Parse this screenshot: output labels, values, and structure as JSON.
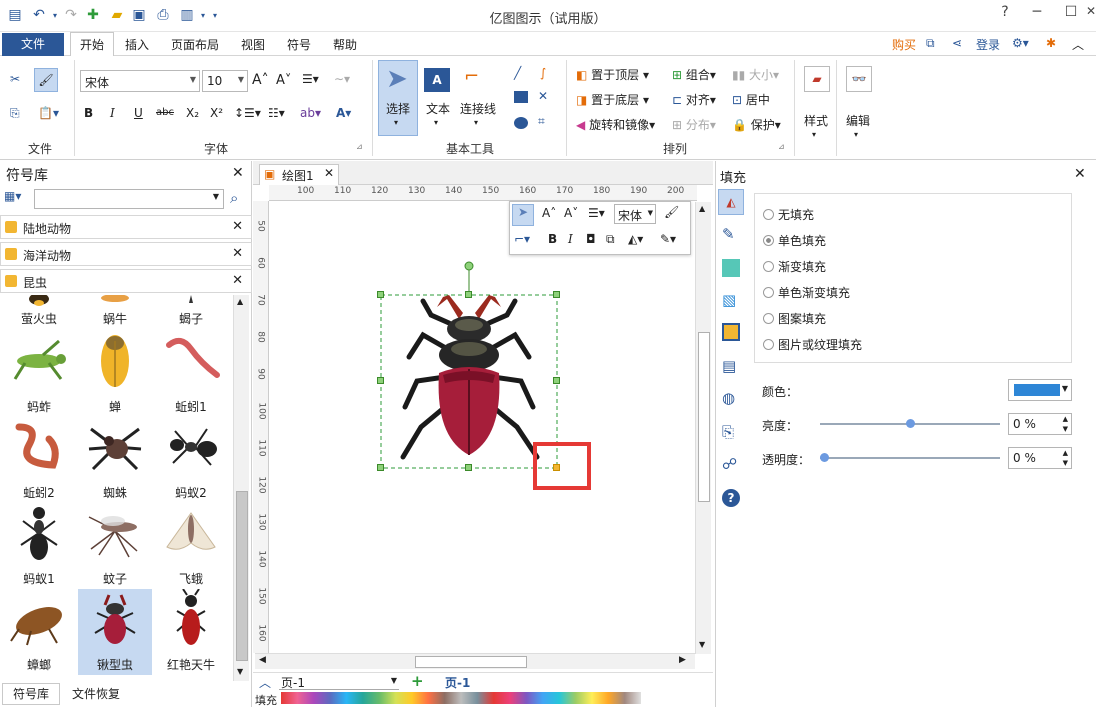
{
  "window": {
    "title": "亿图图示（试用版）",
    "buy": "购买",
    "login": "登录"
  },
  "menu": {
    "file": "文件",
    "tabs": [
      "开始",
      "插入",
      "页面布局",
      "视图",
      "符号",
      "帮助"
    ]
  },
  "ribbon": {
    "groups": {
      "file": "文件",
      "font": "字体",
      "basic": "基本工具",
      "arrange": "排列"
    },
    "font_name": "宋体",
    "font_size": "10",
    "tools": {
      "select": "选择",
      "text": "文本",
      "connector": "连接线"
    },
    "arrange": {
      "bring_front": "置于顶层",
      "send_back": "置于底层",
      "rotate": "旋转和镜像",
      "group": "组合",
      "align": "对齐",
      "distribute": "分布",
      "size": "大小",
      "center": "居中",
      "protect": "保护"
    },
    "style": "样式",
    "edit": "编辑"
  },
  "left_panel": {
    "title": "符号库",
    "search_placeholder": "",
    "libraries": [
      "陆地动物",
      "海洋动物",
      "昆虫"
    ],
    "symbols": [
      {
        "name": "萤火虫"
      },
      {
        "name": "蜗牛"
      },
      {
        "name": "蝎子"
      },
      {
        "name": "蚂蚱"
      },
      {
        "name": "蝉"
      },
      {
        "name": "蚯蚓1"
      },
      {
        "name": "蚯蚓2"
      },
      {
        "name": "蜘蛛"
      },
      {
        "name": "蚂蚁2"
      },
      {
        "name": "蚂蚁1"
      },
      {
        "name": "蚊子"
      },
      {
        "name": "飞蛾"
      },
      {
        "name": "蟑螂"
      },
      {
        "name": "锹型虫"
      },
      {
        "name": "红艳天牛"
      }
    ],
    "bottom_tabs": [
      "符号库",
      "文件恢复"
    ]
  },
  "document": {
    "tab": "绘图1",
    "ruler_h": [
      "100",
      "110",
      "120",
      "130",
      "140",
      "150",
      "160",
      "170",
      "180",
      "190",
      "200"
    ],
    "ruler_v": [
      "50",
      "60",
      "70",
      "80",
      "90",
      "100",
      "110",
      "120",
      "130",
      "140",
      "150",
      "160"
    ],
    "mini_font": "宋体",
    "page_select": "页-1",
    "page_tab": "页-1",
    "fill_label": "填充"
  },
  "right_panel": {
    "title": "填充",
    "options": [
      "无填充",
      "单色填充",
      "渐变填充",
      "单色渐变填充",
      "图案填充",
      "图片或纹理填充"
    ],
    "selected": "单色填充",
    "color_label": "颜色：",
    "color": "#2e86d6",
    "brightness_label": "亮度：",
    "brightness": "0 %",
    "transparency_label": "透明度：",
    "transparency": "0 %"
  },
  "colors": {
    "accent": "#2b5797",
    "highlight": "#e53935",
    "selection": "#c6d9f1"
  }
}
